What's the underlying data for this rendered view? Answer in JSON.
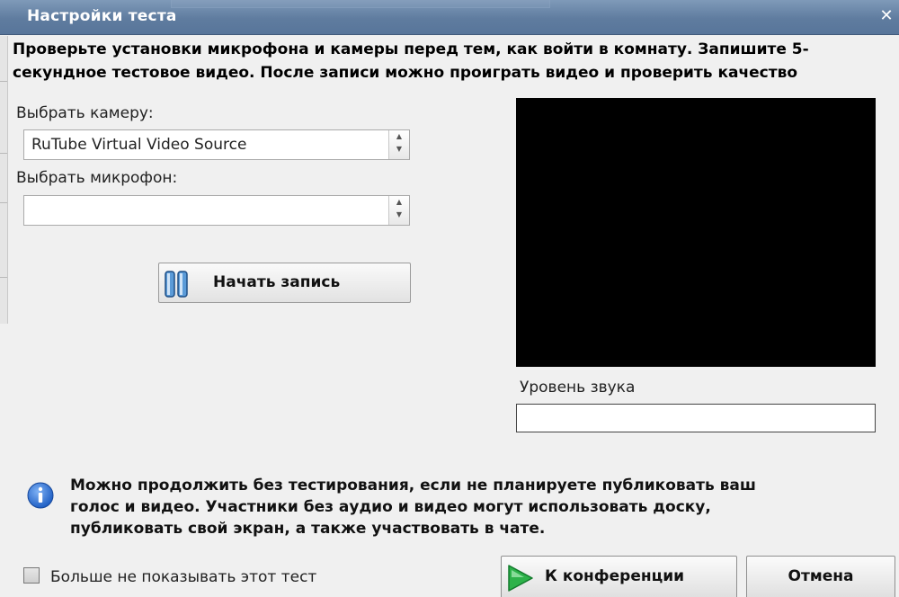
{
  "window": {
    "title": "Настройки теста",
    "close_glyph": "✕",
    "close_icon": "close-icon"
  },
  "instructions": "Проверьте установки микрофона и камеры перед тем, как войти в комнату. Запишите 5-\nсекундное тестовое видео. После записи можно проиграть видео и проверить качество",
  "camera": {
    "label": "Выбрать камеру:",
    "selected": "RuTube Virtual Video Source"
  },
  "microphone": {
    "label": "Выбрать микрофон:",
    "selected": ""
  },
  "record_button": {
    "label": "Начать запись",
    "icon": "pause-icon"
  },
  "sound": {
    "label": "Уровень звука",
    "level": 0
  },
  "info": {
    "icon": "info-icon",
    "text": "Можно продолжить без тестирования, если не планируете публиковать ваш\nголос и видео. Участники без аудио и видео могут использовать доску,\nпубликовать свой экран, а также участвовать в чате."
  },
  "dont_show": {
    "label": "Больше не показывать этот тест",
    "checked": false
  },
  "buttons": {
    "conference": "К конференции",
    "conference_icon": "play-arrow-icon",
    "cancel": "Отмена"
  },
  "colors": {
    "title_bar": "#5f7c9f",
    "video_bg": "#000000",
    "play_icon": "#2db24a",
    "info_icon": "#1f5fc4"
  }
}
